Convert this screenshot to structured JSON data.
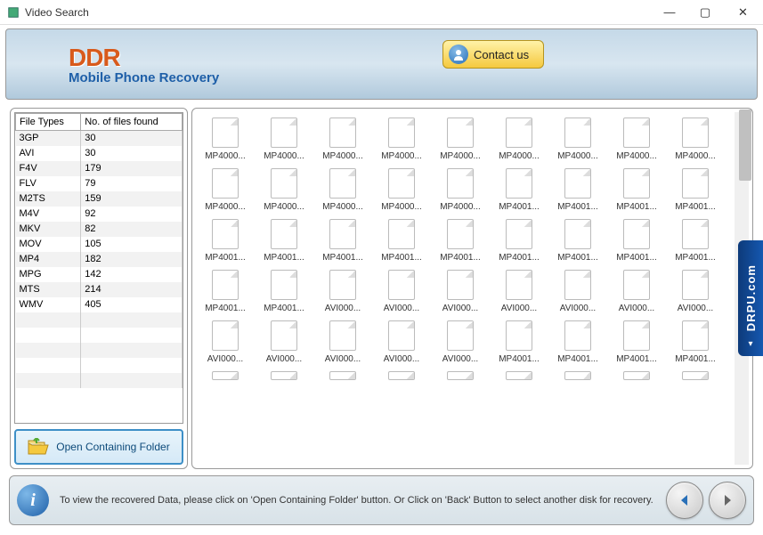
{
  "window": {
    "title": "Video Search"
  },
  "banner": {
    "logo_top": "DDR",
    "logo_sub": "Mobile Phone Recovery",
    "contact_label": "Contact us"
  },
  "table": {
    "header_type": "File Types",
    "header_count": "No. of files found",
    "rows": [
      {
        "type": "3GP",
        "count": "30"
      },
      {
        "type": "AVI",
        "count": "30"
      },
      {
        "type": "F4V",
        "count": "179"
      },
      {
        "type": "FLV",
        "count": "79"
      },
      {
        "type": "M2TS",
        "count": "159"
      },
      {
        "type": "M4V",
        "count": "92"
      },
      {
        "type": "MKV",
        "count": "82"
      },
      {
        "type": "MOV",
        "count": "105"
      },
      {
        "type": "MP4",
        "count": "182"
      },
      {
        "type": "MPG",
        "count": "142"
      },
      {
        "type": "MTS",
        "count": "214"
      },
      {
        "type": "WMV",
        "count": "405"
      }
    ]
  },
  "open_folder_label": "Open Containing Folder",
  "files": {
    "row1": [
      "MP4000...",
      "MP4000...",
      "MP4000...",
      "MP4000...",
      "MP4000...",
      "MP4000...",
      "MP4000...",
      "MP4000...",
      "MP4000..."
    ],
    "row2": [
      "MP4000...",
      "MP4000...",
      "MP4000...",
      "MP4000...",
      "MP4000...",
      "MP4001...",
      "MP4001...",
      "MP4001...",
      "MP4001..."
    ],
    "row3": [
      "MP4001...",
      "MP4001...",
      "MP4001...",
      "MP4001...",
      "MP4001...",
      "MP4001...",
      "MP4001...",
      "MP4001...",
      "MP4001..."
    ],
    "row4": [
      "MP4001...",
      "MP4001...",
      "AVI000...",
      "AVI000...",
      "AVI000...",
      "AVI000...",
      "AVI000...",
      "AVI000...",
      "AVI000..."
    ],
    "row5": [
      "AVI000...",
      "AVI000...",
      "AVI000...",
      "AVI000...",
      "AVI000...",
      "MP4001...",
      "MP4001...",
      "MP4001...",
      "MP4001..."
    ]
  },
  "side_tab": "DRPU.com",
  "footer": {
    "info_text": "To view the recovered Data, please click on 'Open Containing Folder' button. Or Click on 'Back' Button to select another disk for recovery."
  }
}
